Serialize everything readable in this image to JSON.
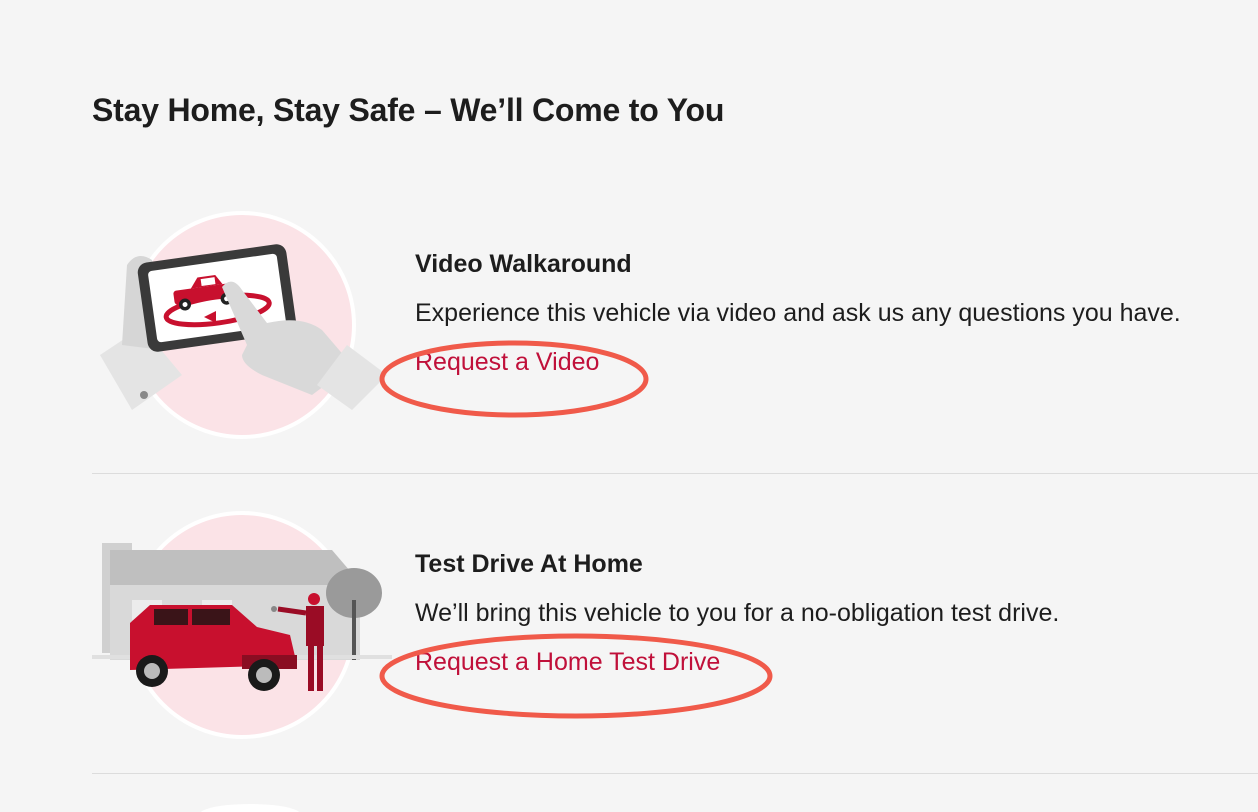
{
  "section": {
    "title": "Stay Home, Stay Safe – We’ll Come to You"
  },
  "items": [
    {
      "title": "Video Walkaround",
      "description": "Experience this vehicle via video and ask us any questions you have.",
      "link": "Request a Video",
      "icon": "phone-video-icon"
    },
    {
      "title": "Test Drive At Home",
      "description": "We’ll bring this vehicle to you for a no-obligation test drive.",
      "link": "Request a Home Test Drive",
      "icon": "home-test-drive-icon"
    }
  ],
  "colors": {
    "background": "#f5f5f5",
    "link": "#c0103a",
    "accent_red": "#c8102e",
    "circle_pink": "#fbe3e7",
    "annotation": "#f05a4a"
  }
}
